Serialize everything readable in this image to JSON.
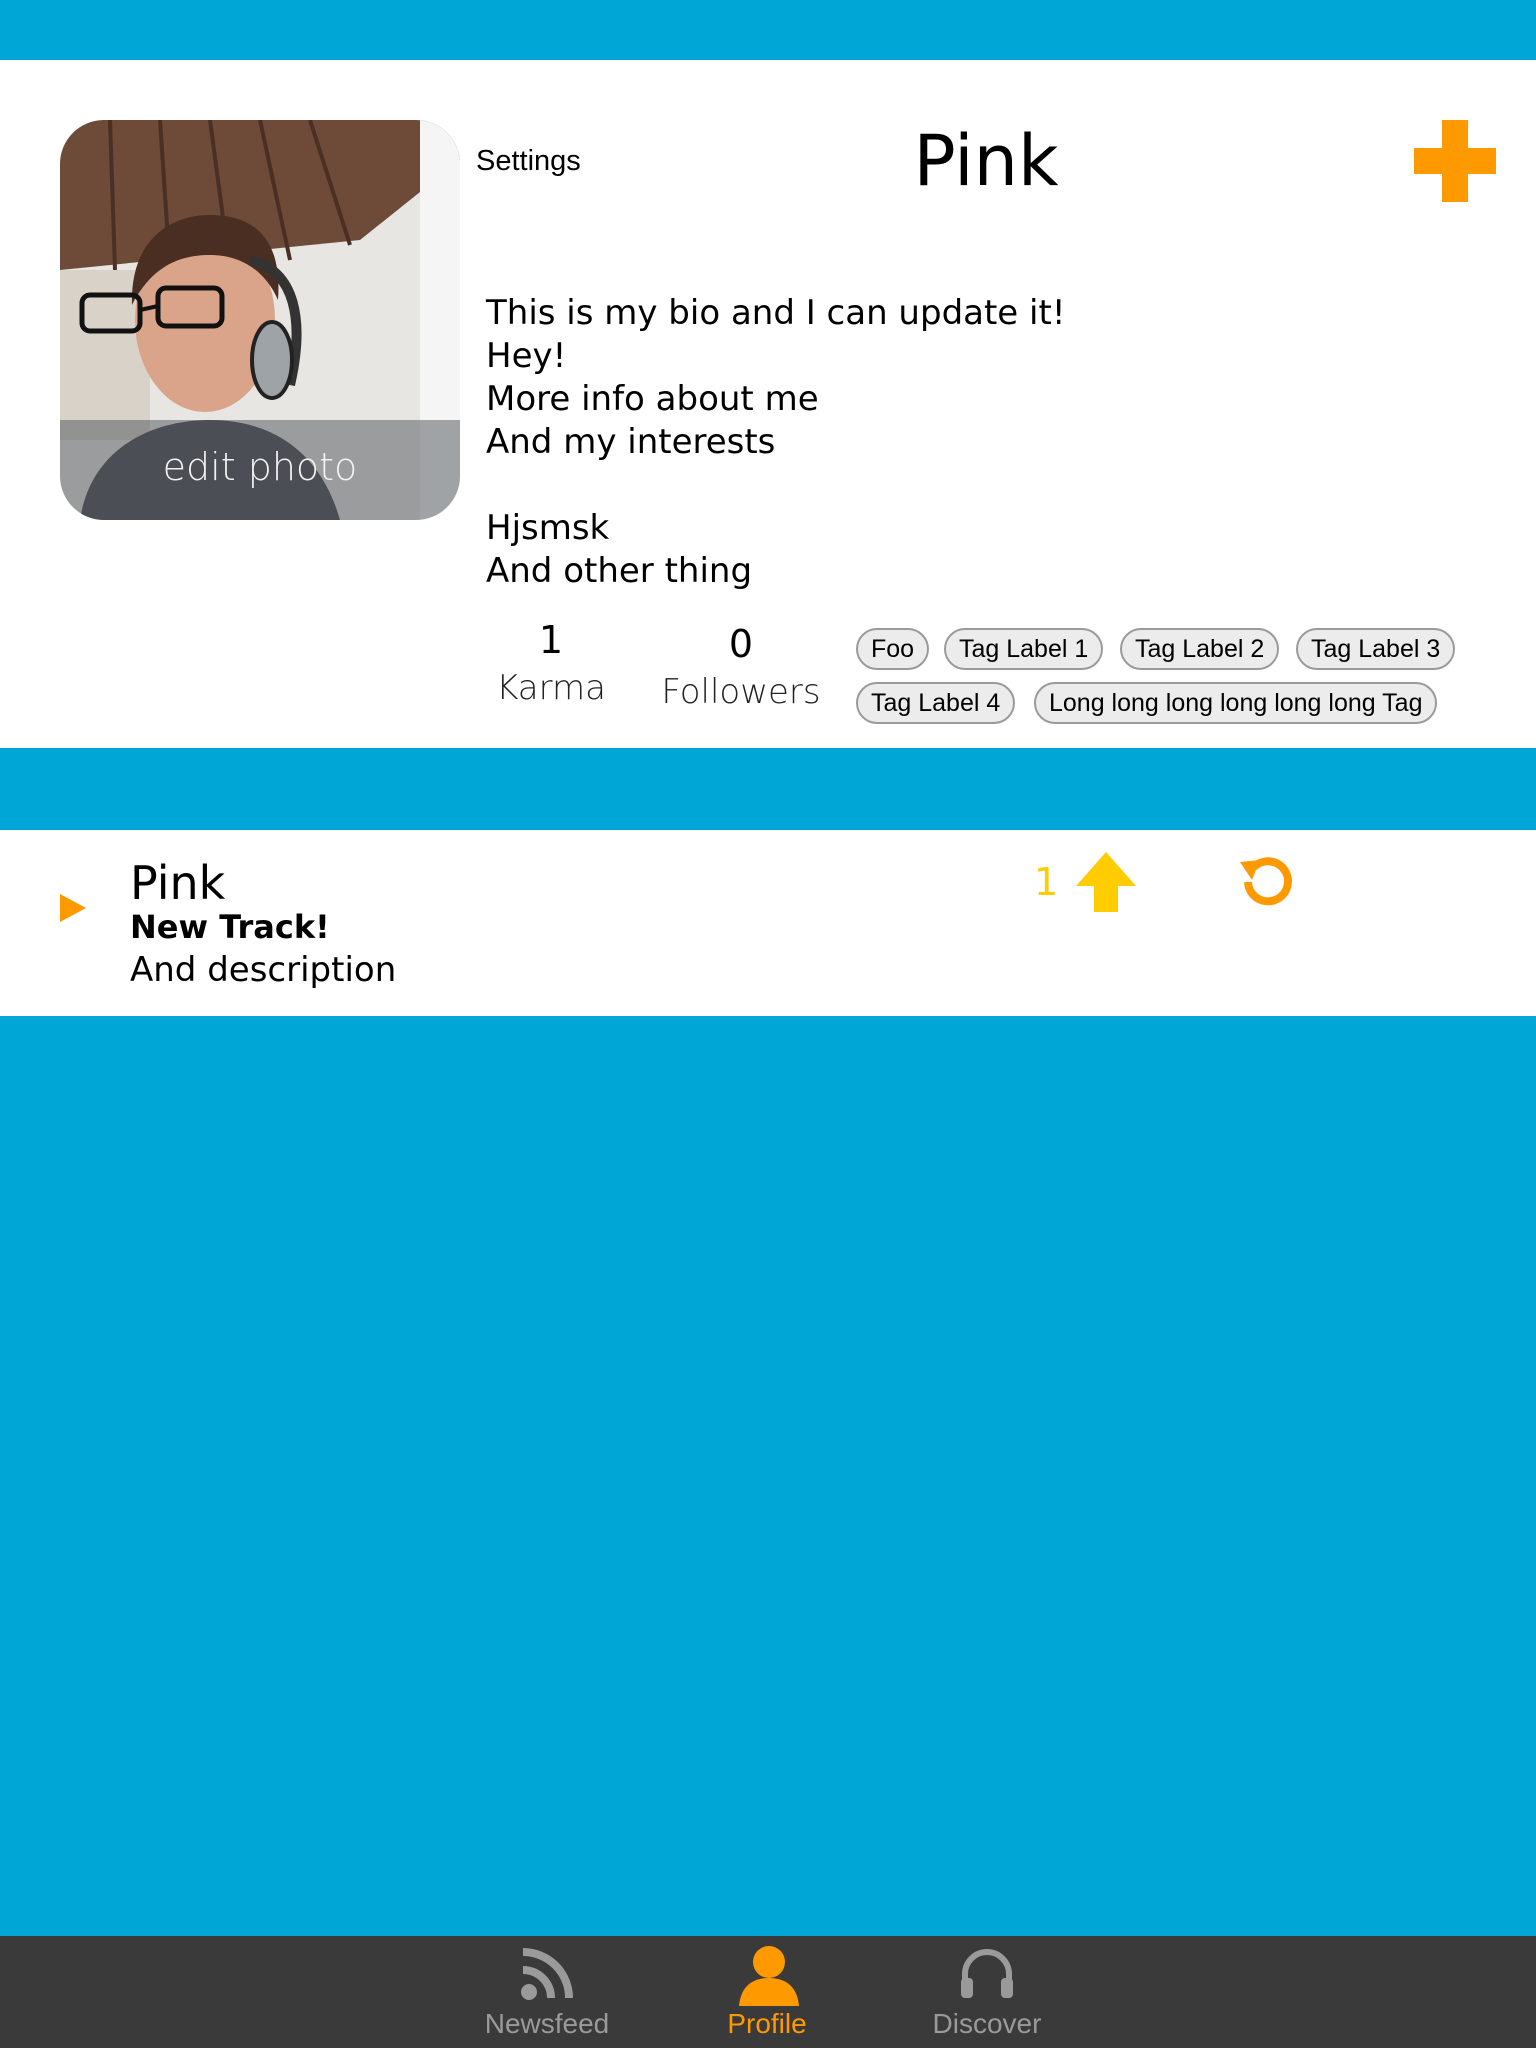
{
  "colors": {
    "background": "#00A6D5",
    "accent": "#FF9900",
    "vote": "#FFCC00",
    "tabbar": "#3a3a3a",
    "tab_inactive": "#9a9a9a"
  },
  "header": {
    "settings_label": "Settings",
    "profile_name": "Pink",
    "add_icon": "plus-icon"
  },
  "avatar": {
    "edit_label": "edit photo"
  },
  "bio": {
    "lines": [
      "This is my bio and I can update it!",
      "Hey!",
      "More info about me",
      "And my interests",
      "",
      "Hjsmsk",
      "And other thing"
    ]
  },
  "stats": {
    "karma_value": "1",
    "karma_label": "Karma",
    "followers_value": "0",
    "followers_label": "Followers"
  },
  "tags": [
    "Foo",
    "Tag Label 1",
    "Tag Label 2",
    "Tag Label 3",
    "Tag Label 4",
    "Long long long long long long Tag"
  ],
  "track": {
    "title": "Pink",
    "subtitle": "New Track!",
    "description": "And description",
    "vote_count": "1",
    "play_icon": "play-icon",
    "upvote_icon": "arrow-up-icon",
    "repost_icon": "repost-icon"
  },
  "tabbar": {
    "tabs": [
      {
        "label": "Newsfeed",
        "icon": "rss-icon",
        "active": false
      },
      {
        "label": "Profile",
        "icon": "person-icon",
        "active": true
      },
      {
        "label": "Discover",
        "icon": "headphones-icon",
        "active": false
      }
    ]
  }
}
